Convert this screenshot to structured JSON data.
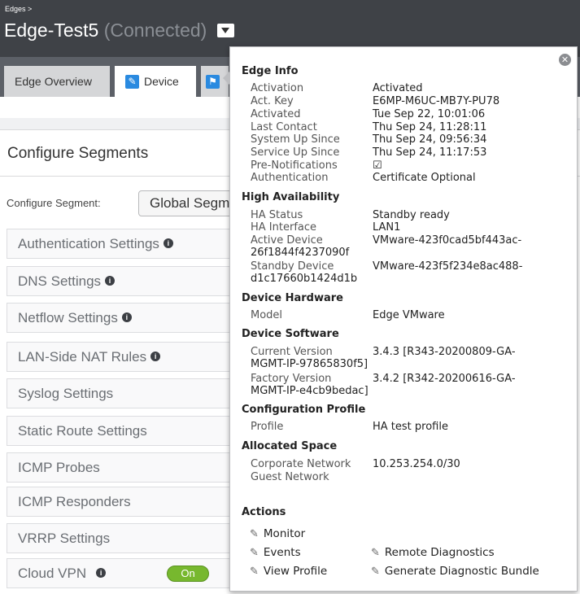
{
  "header": {
    "breadcrumb": "Edges >",
    "edge_name": "Edge-Test5",
    "edge_status": "(Connected)"
  },
  "tabs": [
    {
      "label": "Edge Overview",
      "active": false
    },
    {
      "label": "Device",
      "active": true,
      "icon": "wrench-icon"
    }
  ],
  "segments": {
    "title": "Configure Segments",
    "configure_label": "Configure Segment:",
    "selected_segment": "Global Segment"
  },
  "settings": [
    {
      "label": "Authentication Settings",
      "info": true
    },
    {
      "label": "DNS Settings",
      "info": true
    },
    {
      "label": "Netflow Settings",
      "info": true
    },
    {
      "label": "LAN-Side NAT Rules",
      "info": true
    },
    {
      "label": "Syslog Settings",
      "info": false
    },
    {
      "label": "Static Route Settings",
      "info": false
    },
    {
      "label": "ICMP Probes",
      "info": false
    },
    {
      "label": "ICMP Responders",
      "info": false
    },
    {
      "label": "VRRP Settings",
      "info": false
    },
    {
      "label": "Cloud VPN",
      "info": true,
      "toggle": "On"
    }
  ],
  "popup": {
    "edge_info": {
      "title": "Edge Info",
      "activation_label": "Activation",
      "activation_value": "Activated",
      "act_key_label": "Act. Key",
      "act_key_value": "E6MP-M6UC-MB7Y-PU78",
      "activated_label": "Activated",
      "activated_value": "Tue Sep 22, 10:01:06",
      "last_contact_label": "Last Contact",
      "last_contact_value": "Thu Sep 24, 11:28:11",
      "system_up_label": "System Up Since",
      "system_up_value": "Thu Sep 24, 09:56:34",
      "service_up_label": "Service Up Since",
      "service_up_value": "Thu Sep 24, 11:17:53",
      "pre_notifications_label": "Pre-Notifications",
      "pre_notifications_value": "☑",
      "authentication_label": "Authentication",
      "authentication_value": "Certificate Optional"
    },
    "ha": {
      "title": "High Availability",
      "status_label": "HA Status",
      "status_value": "Standby ready",
      "interface_label": "HA Interface",
      "interface_value": "LAN1",
      "active_device_label": "Active Device",
      "active_device_value": "VMware-423f0cad5bf443ac-",
      "active_device_cont": "26f1844f4237090f",
      "standby_device_label": "Standby Device",
      "standby_device_value": "VMware-423f5f234e8ac488-",
      "standby_device_cont": "d1c17660b1424d1b"
    },
    "hardware": {
      "title": "Device Hardware",
      "model_label": "Model",
      "model_value": "Edge VMware"
    },
    "software": {
      "title": "Device Software",
      "current_label": "Current Version",
      "current_value": "3.4.3 [R343-20200809-GA-",
      "current_cont": "MGMT-IP-97865830f5]",
      "factory_label": "Factory Version",
      "factory_value": "3.4.2 [R342-20200616-GA-",
      "factory_cont": "MGMT-IP-e4cb9bedac]"
    },
    "profile": {
      "title": "Configuration Profile",
      "profile_label": "Profile",
      "profile_value": "HA test profile"
    },
    "space": {
      "title": "Allocated Space",
      "corporate_label": "Corporate Network",
      "corporate_value": "10.253.254.0/30",
      "guest_label": "Guest Network"
    },
    "actions": {
      "title": "Actions",
      "monitor": "Monitor",
      "events": "Events",
      "view_profile": "View Profile",
      "remote_diagnostics": "Remote Diagnostics",
      "diagnostic_bundle": "Generate Diagnostic Bundle"
    },
    "close_glyph": "✕",
    "edit_glyph": "✎"
  }
}
